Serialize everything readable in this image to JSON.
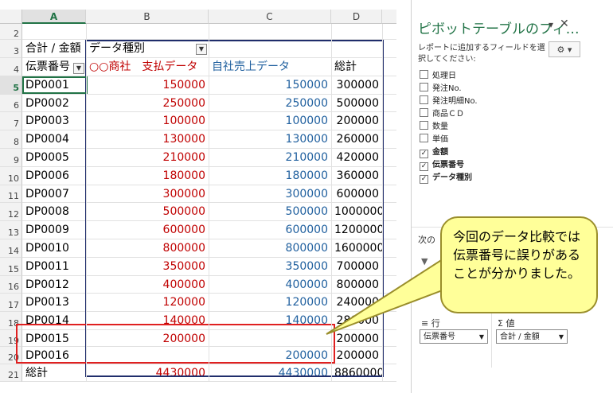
{
  "sheet": {
    "columns": [
      "A",
      "B",
      "C",
      "D"
    ],
    "row_numbers": [
      "2",
      "3",
      "4",
      "5",
      "6",
      "7",
      "8",
      "9",
      "10",
      "11",
      "12",
      "13",
      "14",
      "15",
      "16",
      "17",
      "18",
      "19",
      "20",
      "21"
    ],
    "pivot_header": {
      "value_label": "合計 / 金額",
      "column_field": "データ種別",
      "row_field": "伝票番号",
      "col_b": "○○商社　支払データ",
      "col_c": "自社売上データ",
      "col_d": "総計"
    },
    "rows": [
      {
        "id": "DP0001",
        "b": "150000",
        "c": "150000",
        "d": "300000"
      },
      {
        "id": "DP0002",
        "b": "250000",
        "c": "250000",
        "d": "500000"
      },
      {
        "id": "DP0003",
        "b": "100000",
        "c": "100000",
        "d": "200000"
      },
      {
        "id": "DP0004",
        "b": "130000",
        "c": "130000",
        "d": "260000"
      },
      {
        "id": "DP0005",
        "b": "210000",
        "c": "210000",
        "d": "420000"
      },
      {
        "id": "DP0006",
        "b": "180000",
        "c": "180000",
        "d": "360000"
      },
      {
        "id": "DP0007",
        "b": "300000",
        "c": "300000",
        "d": "600000"
      },
      {
        "id": "DP0008",
        "b": "500000",
        "c": "500000",
        "d": "1000000"
      },
      {
        "id": "DP0009",
        "b": "600000",
        "c": "600000",
        "d": "1200000"
      },
      {
        "id": "DP0010",
        "b": "800000",
        "c": "800000",
        "d": "1600000"
      },
      {
        "id": "DP0011",
        "b": "350000",
        "c": "350000",
        "d": "700000"
      },
      {
        "id": "DP0012",
        "b": "400000",
        "c": "400000",
        "d": "800000"
      },
      {
        "id": "DP0013",
        "b": "120000",
        "c": "120000",
        "d": "240000"
      },
      {
        "id": "DP0014",
        "b": "140000",
        "c": "140000",
        "d": "280000"
      },
      {
        "id": "DP0015",
        "b": "200000",
        "c": "",
        "d": "200000"
      },
      {
        "id": "DP0016",
        "b": "",
        "c": "200000",
        "d": "200000"
      }
    ],
    "total": {
      "label": "総計",
      "b": "4430000",
      "c": "4430000",
      "d": "8860000"
    }
  },
  "pane": {
    "title": "ピボットテーブルのフィ…",
    "subtitle": "レポートに追加するフィールドを選択してください:",
    "fields": [
      {
        "label": "処理日",
        "checked": false
      },
      {
        "label": "発注No.",
        "checked": false
      },
      {
        "label": "発注明細No.",
        "checked": false
      },
      {
        "label": "商品ＣＤ",
        "checked": false
      },
      {
        "label": "数量",
        "checked": false
      },
      {
        "label": "単価",
        "checked": false
      },
      {
        "label": "金額",
        "checked": true
      },
      {
        "label": "伝票番号",
        "checked": true
      },
      {
        "label": "データ種別",
        "checked": true
      }
    ],
    "areas_hint": "次の",
    "rows_area_label": "行",
    "values_area_label": "値",
    "rows_area_value": "伝票番号",
    "values_area_value": "合計 / 金額"
  },
  "callout": {
    "line1": "今回のデータ比較では",
    "line2": "伝票番号に誤りがある",
    "line3": "ことが分かりました。"
  },
  "colors": {
    "accent_green": "#217346",
    "red_text": "#c00000",
    "blue_text": "#1f5f9e",
    "callout_fill": "#ffff99",
    "highlight_red": "#e02020"
  }
}
